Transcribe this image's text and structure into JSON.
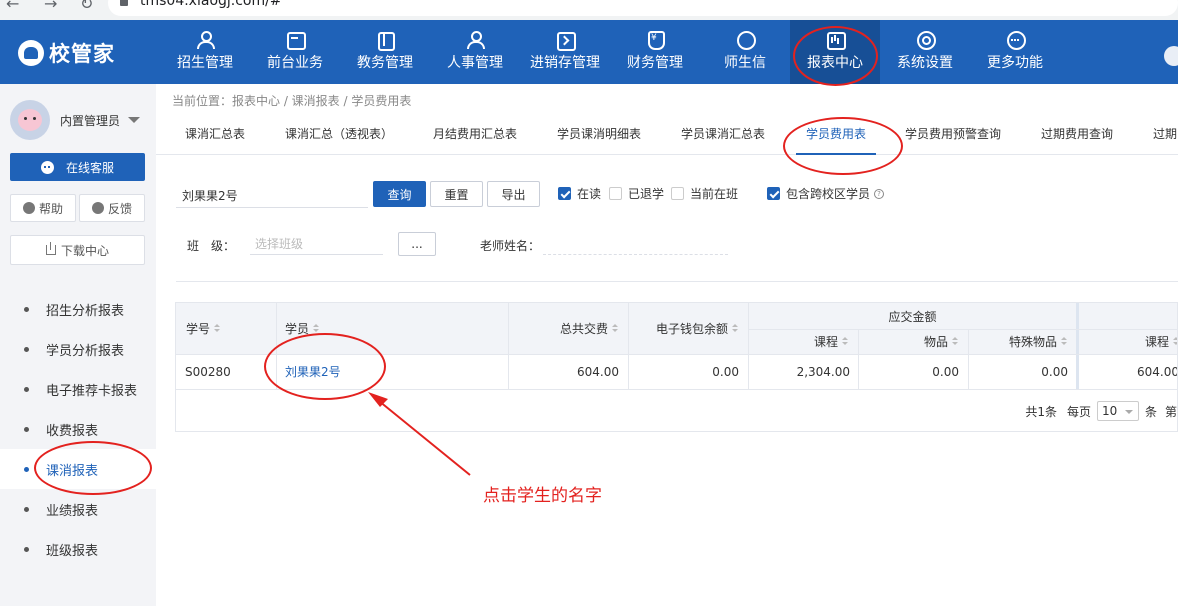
{
  "browser": {
    "url": "tms04.xiaogj.com/#"
  },
  "brand": {
    "name": "校管家"
  },
  "topnav": {
    "items": [
      {
        "label": "招生管理",
        "icon": "person-plus-icon"
      },
      {
        "label": "前台业务",
        "icon": "monitor-icon"
      },
      {
        "label": "教务管理",
        "icon": "book-icon"
      },
      {
        "label": "人事管理",
        "icon": "person-icon"
      },
      {
        "label": "进销存管理",
        "icon": "inventory-icon"
      },
      {
        "label": "财务管理",
        "icon": "finance-icon"
      },
      {
        "label": "师生信",
        "icon": "message-icon"
      },
      {
        "label": "报表中心",
        "icon": "report-icon"
      },
      {
        "label": "系统设置",
        "icon": "settings-icon"
      },
      {
        "label": "更多功能",
        "icon": "more-icon"
      }
    ],
    "active_label": "报表中心"
  },
  "sidebar": {
    "user_name": "内置管理员",
    "service_label": "在线客服",
    "help_label": "帮助",
    "feedback_label": "反馈",
    "download_label": "下载中心",
    "menu": [
      {
        "label": "招生分析报表"
      },
      {
        "label": "学员分析报表"
      },
      {
        "label": "电子推荐卡报表"
      },
      {
        "label": "收费报表"
      },
      {
        "label": "课消报表"
      },
      {
        "label": "业绩报表"
      },
      {
        "label": "班级报表"
      }
    ],
    "active_label": "课消报表"
  },
  "breadcrumb": "当前位置：报表中心 / 课消报表 / 学员费用表",
  "tabs": [
    {
      "label": "课消汇总表"
    },
    {
      "label": "课消汇总（透视表）"
    },
    {
      "label": "月结费用汇总表"
    },
    {
      "label": "学员课消明细表"
    },
    {
      "label": "学员课消汇总表"
    },
    {
      "label": "学员费用表"
    },
    {
      "label": "学员费用预警查询"
    },
    {
      "label": "过期费用查询"
    },
    {
      "label": "过期"
    }
  ],
  "active_tab": "学员费用表",
  "filters": {
    "search_value": "刘果果2号",
    "query_label": "查询",
    "reset_label": "重置",
    "export_label": "导出",
    "checkboxes": [
      {
        "label": "在读",
        "checked": true
      },
      {
        "label": "已退学",
        "checked": false
      },
      {
        "label": "当前在班",
        "checked": false
      },
      {
        "label": "包含跨校区学员",
        "checked": true
      }
    ],
    "class_label": "班　级：",
    "class_placeholder": "选择班级",
    "class_button": "...",
    "teacher_label": "老师姓名："
  },
  "table": {
    "headers": {
      "student_no": "学号",
      "student": "学员",
      "total_paid": "总共交费",
      "wallet_balance": "电子钱包余额",
      "due_group": "应交金额",
      "course": "课程",
      "goods": "物品",
      "special_goods": "特殊物品",
      "course_2": "课程"
    },
    "rows": [
      {
        "student_no": "S00280",
        "student": "刘果果2号",
        "total_paid": "604.00",
        "wallet_balance": "0.00",
        "course": "2,304.00",
        "goods": "0.00",
        "special_goods": "0.00",
        "course_2": "604.00"
      }
    ],
    "pager": {
      "total": "共1条",
      "per_page_label": "每页",
      "per_page_value": "10",
      "unit": "条",
      "tail": "第"
    }
  },
  "annotation": {
    "note": "点击学生的名字",
    "color": "#e3221f"
  },
  "colors": {
    "brand_blue": "#1f62b8",
    "sidebar_bg": "#f3f4f7"
  }
}
